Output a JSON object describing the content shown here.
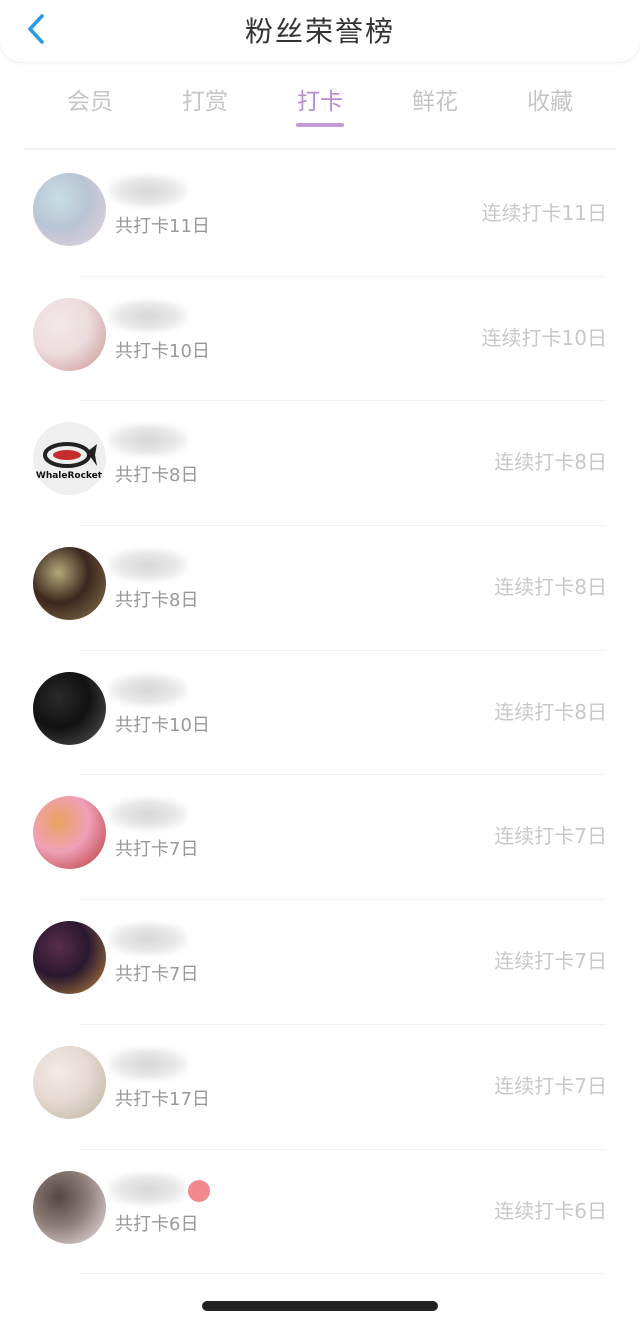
{
  "header": {
    "title": "粉丝荣誉榜",
    "back_icon": "chevron-left-icon",
    "back_color": "#2a9de0"
  },
  "tabs": [
    {
      "label": "会员",
      "active": false
    },
    {
      "label": "打赏",
      "active": false
    },
    {
      "label": "打卡",
      "active": true
    },
    {
      "label": "鲜花",
      "active": false
    },
    {
      "label": "收藏",
      "active": false
    }
  ],
  "colors": {
    "accent": "#b98ad4",
    "inactive_tab": "#c5c5c5",
    "secondary_text": "#999999"
  },
  "rows": [
    {
      "total": "共打卡11日",
      "streak": "连续打卡11日",
      "avatar_colors": [
        "#b9c4d6",
        "#e9d2d8",
        "#c7dfe3"
      ],
      "badge": false
    },
    {
      "total": "共打卡10日",
      "streak": "连续打卡10日",
      "avatar_colors": [
        "#eddcde",
        "#c9908c",
        "#f2e9ea"
      ],
      "badge": false
    },
    {
      "total": "共打卡8日",
      "streak": "连续打卡8日",
      "avatar_colors": [
        "#f1f1f1",
        "#e8e8e8",
        "#d8d8d8"
      ],
      "badge": false,
      "logo_text": "WhaleRocket"
    },
    {
      "total": "共打卡8日",
      "streak": "连续打卡8日",
      "avatar_colors": [
        "#3d261d",
        "#8a7a4f",
        "#b4a97a"
      ],
      "badge": false
    },
    {
      "total": "共打卡10日",
      "streak": "连续打卡8日",
      "avatar_colors": [
        "#111111",
        "#5a5a5a",
        "#2a2a2a"
      ],
      "badge": false
    },
    {
      "total": "共打卡7日",
      "streak": "连续打卡7日",
      "avatar_colors": [
        "#f0a0b8",
        "#b3322f",
        "#e8a35e"
      ],
      "badge": false
    },
    {
      "total": "共打卡7日",
      "streak": "连续打卡7日",
      "avatar_colors": [
        "#2a1830",
        "#c08a3c",
        "#5a2d49"
      ],
      "badge": false
    },
    {
      "total": "共打卡17日",
      "streak": "连续打卡7日",
      "avatar_colors": [
        "#e5d9d2",
        "#b9b19b",
        "#f3ebe6"
      ],
      "badge": false
    },
    {
      "total": "共打卡6日",
      "streak": "连续打卡6日",
      "avatar_colors": [
        "#8e7e78",
        "#f2eaea",
        "#544541"
      ],
      "badge": true
    }
  ]
}
